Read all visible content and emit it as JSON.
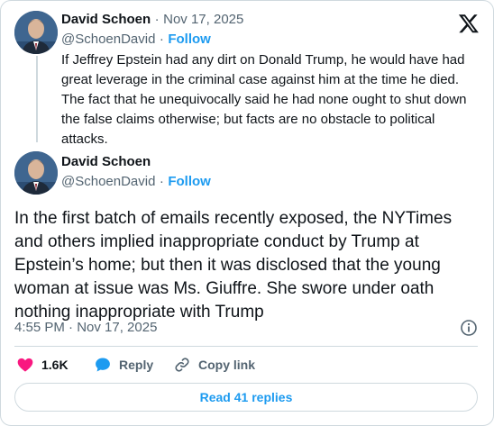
{
  "quoted": {
    "author_name": "David Schoen",
    "separator": "·",
    "date": "Nov 17, 2025",
    "handle": "@SchoenDavid",
    "follow_label": "Follow",
    "text": "If Jeffrey Epstein had any dirt on Donald Trump, he would have had great leverage in the criminal case against him at the time he died. The fact that he unequivocally said he had none ought to shut down the false claims otherwise; but facts are no obstacle to political attacks."
  },
  "post": {
    "author_name": "David Schoen",
    "handle": "@SchoenDavid",
    "separator": "·",
    "follow_label": "Follow",
    "text": "In the first batch of emails recently exposed, the NYTimes and others implied inappropriate conduct by Trump at Epstein’s home; but then it was disclosed that the young woman at issue was Ms. Giuffre.  She swore under oath nothing inappropriate with Trump",
    "timestamp": "4:55 PM · Nov 17, 2025"
  },
  "actions": {
    "like_count": "1.6K",
    "reply_label": "Reply",
    "copy_link_label": "Copy link"
  },
  "read_replies_label": "Read 41 replies",
  "icons": {
    "brand": "x-logo-icon",
    "like": "heart-icon",
    "reply": "speech-bubble-icon",
    "copy": "link-icon",
    "info": "info-icon"
  },
  "colors": {
    "accent": "#1d9bf0",
    "like": "#f91880",
    "text": "#0f1419",
    "muted": "#536471",
    "border": "#cfd9de"
  }
}
